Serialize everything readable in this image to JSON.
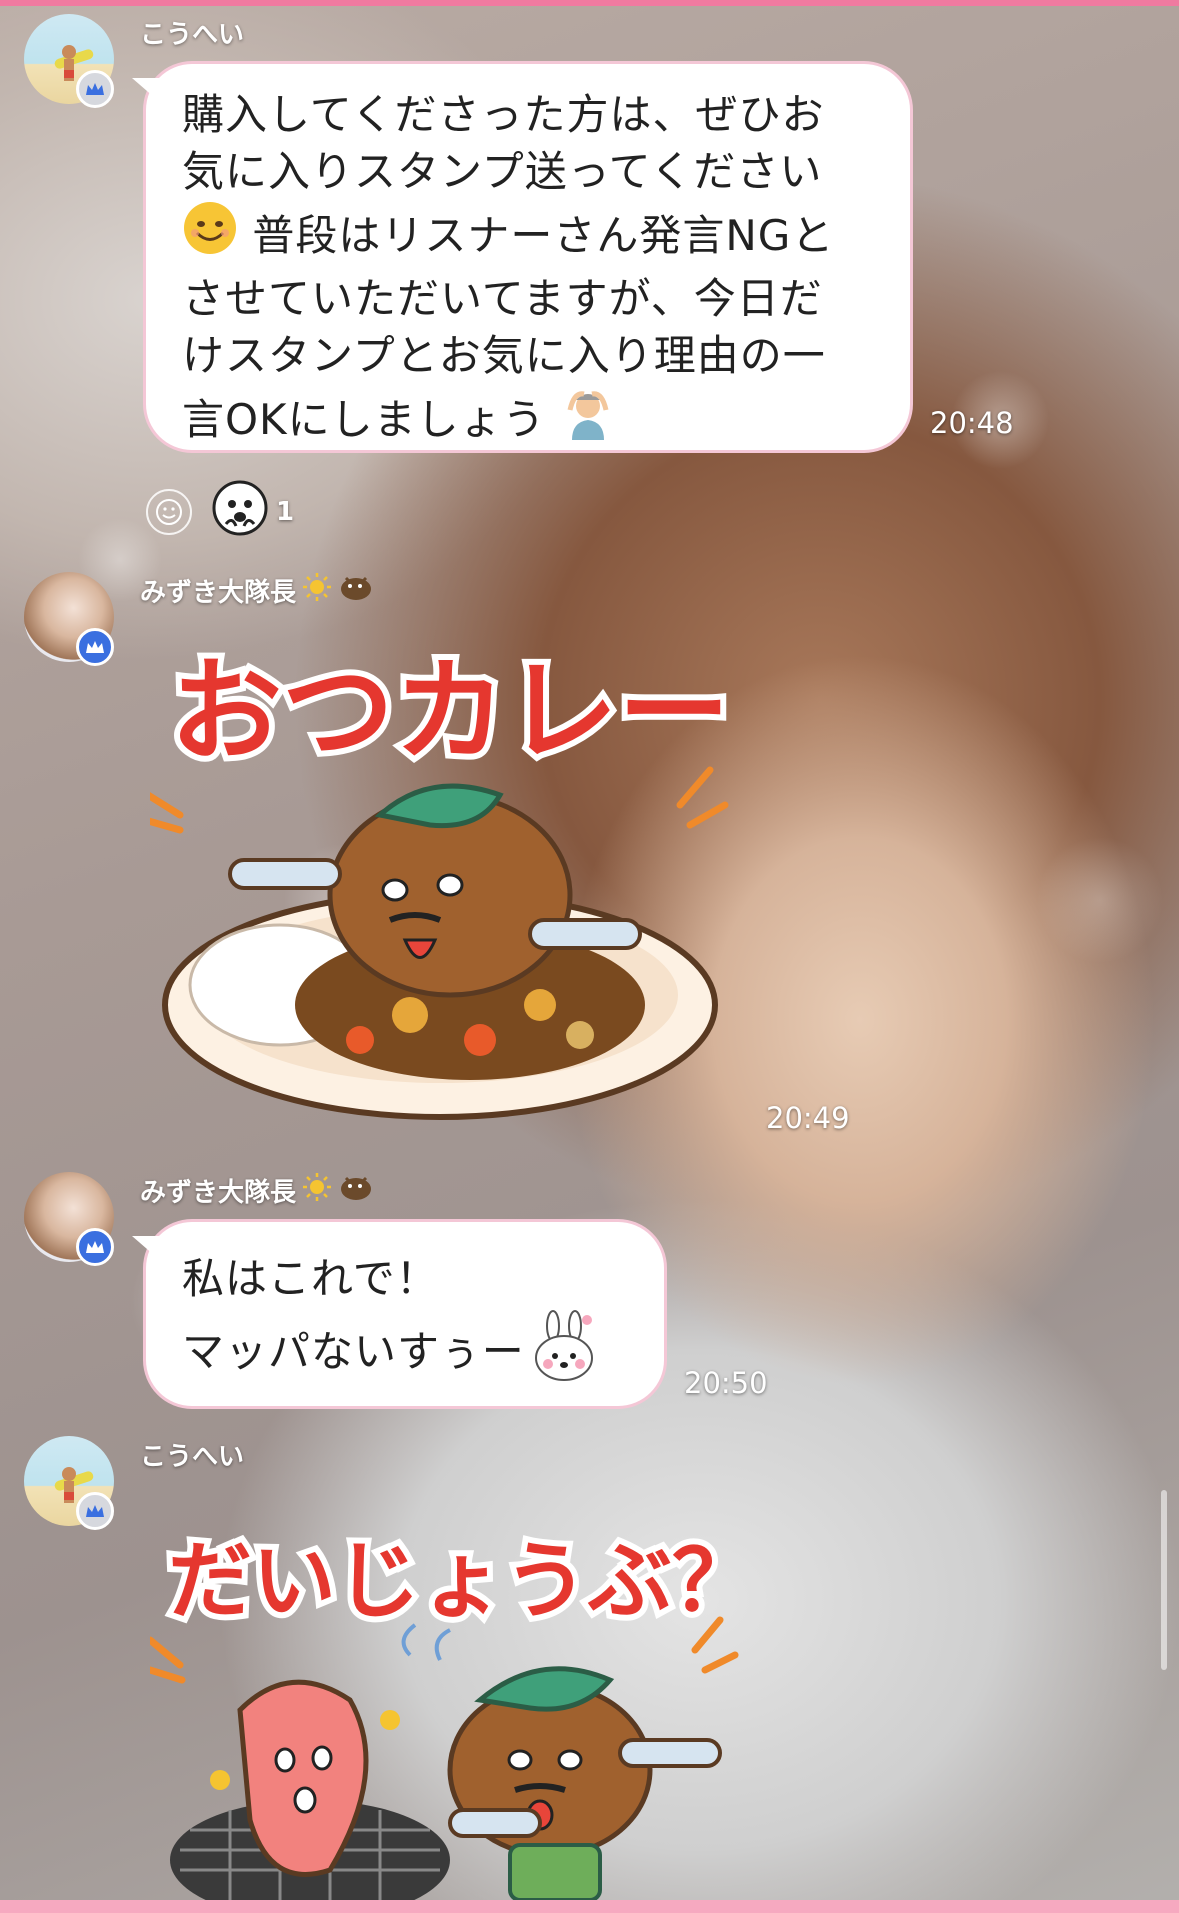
{
  "messages": [
    {
      "sender": "こうへい",
      "lines": [
        "購入してくださった方は、ぜひお",
        "気に入りスタンプ送ってください",
        "普段はリスナーさん発言NGと",
        "させていただいてますが、今日だ",
        "けスタンプとお気に入り理由の一",
        "言OKにしましょう"
      ],
      "time": "20:48",
      "reaction_count": "1"
    },
    {
      "sender": "みずき大隊長",
      "sticker_text": "おつカレー",
      "time": "20:49"
    },
    {
      "sender": "みずき大隊長",
      "lines": [
        "私はこれで！",
        "マッパないすぅー"
      ],
      "time": "20:50"
    },
    {
      "sender": "こうへい",
      "sticker_text": "だいじょうぶ？"
    }
  ],
  "icons": [
    "crown-badge-icon",
    "smile-add-reaction-icon",
    "reaction-sticker-icon",
    "sun-emoji-icon",
    "kiwi-emoji-icon",
    "smile-emoji-icon",
    "person-gesture-emoji-icon",
    "bunny-sticker-icon"
  ],
  "colors": {
    "accent_pink": "#f07aa0",
    "badge_blue": "#3a6fe0",
    "sticker_red": "#e5372f"
  }
}
